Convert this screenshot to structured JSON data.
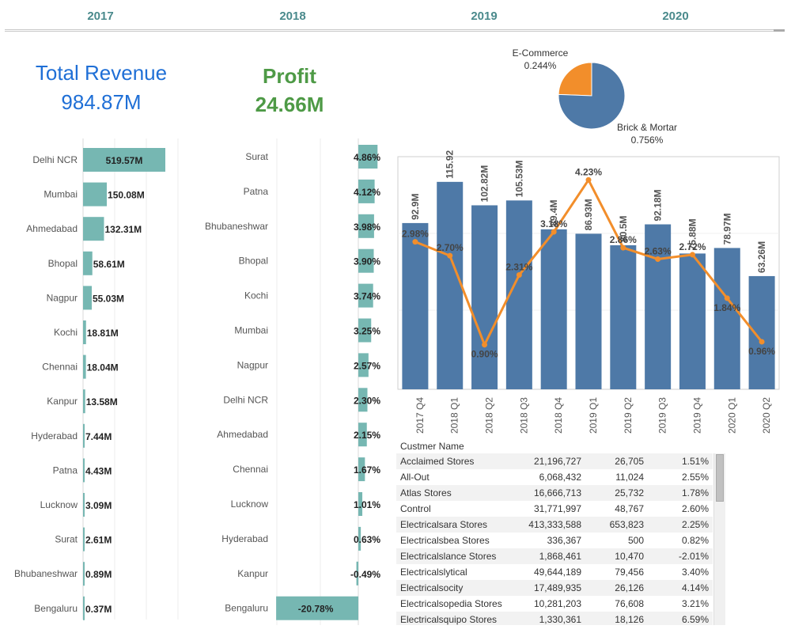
{
  "years": [
    "2017",
    "2018",
    "2019",
    "2020"
  ],
  "kpis": {
    "revenue": {
      "title": "Total Revenue",
      "value": "984.87M",
      "color": "#1f6fd6"
    },
    "profit": {
      "title": "Profit",
      "value": "24.66M",
      "color": "#4e9a46"
    }
  },
  "colors": {
    "teal": "#76b7b2",
    "blue": "#4e79a7",
    "orange": "#f28e2b"
  },
  "chart_data": [
    {
      "type": "bar",
      "orientation": "horizontal",
      "categories": [
        "Delhi NCR",
        "Mumbai",
        "Ahmedabad",
        "Bhopal",
        "Nagpur",
        "Kochi",
        "Chennai",
        "Kanpur",
        "Hyderabad",
        "Patna",
        "Lucknow",
        "Surat",
        "Bhubaneshwar",
        "Bengaluru"
      ],
      "values": [
        519.57,
        150.08,
        132.31,
        58.61,
        55.03,
        18.81,
        18.04,
        13.58,
        7.44,
        4.43,
        3.09,
        2.61,
        0.89,
        0.37
      ],
      "labels": [
        "519.57M",
        "150.08M",
        "132.31M",
        "58.61M",
        "55.03M",
        "18.81M",
        "18.04M",
        "13.58M",
        "7.44M",
        "4.43M",
        "3.09M",
        "2.61M",
        "0.89M",
        "0.37M"
      ]
    },
    {
      "type": "bar",
      "orientation": "horizontal",
      "categories": [
        "Surat",
        "Patna",
        "Bhubaneshwar",
        "Bhopal",
        "Kochi",
        "Mumbai",
        "Nagpur",
        "Delhi NCR",
        "Ahmedabad",
        "Chennai",
        "Lucknow",
        "Hyderabad",
        "Kanpur",
        "Bengaluru"
      ],
      "values": [
        4.86,
        4.12,
        3.98,
        3.9,
        3.74,
        3.25,
        2.57,
        2.3,
        2.15,
        1.67,
        1.01,
        0.63,
        -0.49,
        -20.78
      ],
      "labels": [
        "4.86%",
        "4.12%",
        "3.98%",
        "3.90%",
        "3.74%",
        "3.25%",
        "2.57%",
        "2.30%",
        "2.15%",
        "1.67%",
        "1.01%",
        "0.63%",
        "-0.49%",
        "-20.78%"
      ]
    },
    {
      "type": "pie",
      "slices": [
        {
          "name": "E-Commerce",
          "label": "0.244%",
          "value": 0.244
        },
        {
          "name": "Brick & Mortar",
          "label": "0.756%",
          "value": 0.756
        }
      ]
    },
    {
      "type": "bar+line",
      "categories": [
        "2017 Q4",
        "2018 Q1",
        "2018 Q2",
        "2018 Q3",
        "2018 Q4",
        "2019 Q1",
        "2019 Q2",
        "2019 Q3",
        "2019 Q4",
        "2020 Q1",
        "2020 Q2"
      ],
      "bars": {
        "values": [
          92.9,
          115.92,
          102.82,
          105.53,
          89.4,
          86.93,
          80.5,
          92.18,
          75.88,
          78.97,
          63.26
        ],
        "labels": [
          "92.9M",
          "115.92M",
          "102.82M",
          "105.53M",
          "89.4M",
          "86.93M",
          "80.5M",
          "92.18M",
          "75.88M",
          "78.97M",
          "63.26M"
        ],
        "ylim": [
          0,
          130
        ]
      },
      "line": {
        "values": [
          2.98,
          2.7,
          0.9,
          2.31,
          3.18,
          4.23,
          2.86,
          2.63,
          2.72,
          1.84,
          0.96
        ],
        "labels": [
          "2.98%",
          "2.70%",
          "0.90%",
          "2.31%",
          "3.18%",
          "4.23%",
          "2.86%",
          "2.63%",
          "2.72%",
          "1.84%",
          "0.96%"
        ],
        "ylim": [
          0,
          4.7
        ]
      }
    }
  ],
  "table": {
    "header": "Custmer Name",
    "rows": [
      [
        "Acclaimed Stores",
        "21,196,727",
        "26,705",
        "1.51%"
      ],
      [
        "All-Out",
        "6,068,432",
        "11,024",
        "2.55%"
      ],
      [
        "Atlas Stores",
        "16,666,713",
        "25,732",
        "1.78%"
      ],
      [
        "Control",
        "31,771,997",
        "48,767",
        "2.60%"
      ],
      [
        "Electricalsara Stores",
        "413,333,588",
        "653,823",
        "2.25%"
      ],
      [
        "Electricalsbea Stores",
        "336,367",
        "500",
        "0.82%"
      ],
      [
        "Electricalslance Stores",
        "1,868,461",
        "10,470",
        "-2.01%"
      ],
      [
        "Electricalslytical",
        "49,644,189",
        "79,456",
        "3.40%"
      ],
      [
        "Electricalsocity",
        "17,489,935",
        "26,126",
        "4.14%"
      ],
      [
        "Electricalsopedia Stores",
        "10,281,203",
        "76,608",
        "3.21%"
      ],
      [
        "Electricalsquipo Stores",
        "1,330,361",
        "18,126",
        "6.59%"
      ]
    ]
  }
}
